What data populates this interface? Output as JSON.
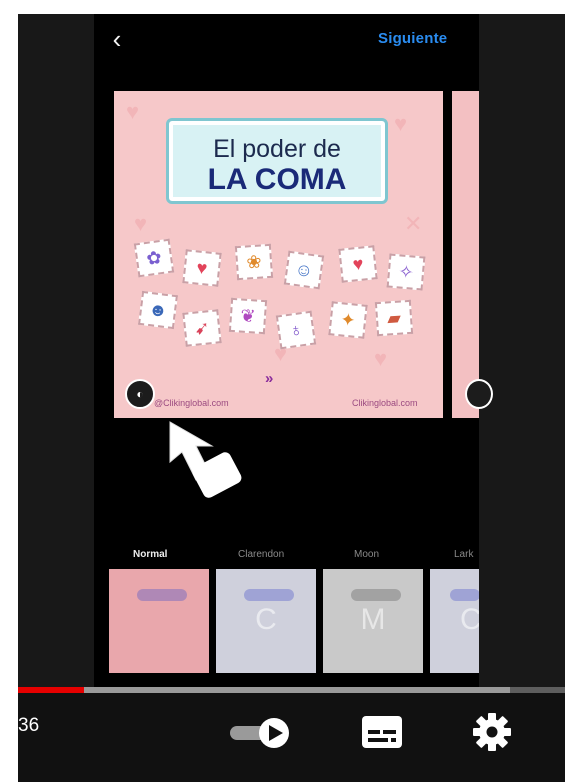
{
  "header": {
    "back_icon": "chevron-left-icon",
    "next_label": "Siguiente"
  },
  "post": {
    "title_line1": "El poder de",
    "title_line2": "LA COMA",
    "arrows": "»",
    "handle_left": "@Clikinglobal.com",
    "handle_right": "Clikinglobal.com"
  },
  "filters": {
    "items": [
      {
        "label": "Normal",
        "letter": "",
        "active": true
      },
      {
        "label": "Clarendon",
        "letter": "C",
        "active": false
      },
      {
        "label": "Moon",
        "letter": "M",
        "active": false
      },
      {
        "label": "Lark",
        "letter": "C",
        "active": false
      }
    ]
  },
  "player": {
    "time": "36",
    "progress_played": 0.12,
    "progress_buffered": 0.9,
    "autoplay_icon": "autoplay-toggle-icon",
    "captions_icon": "closed-captions-icon",
    "settings_icon": "gear-icon"
  },
  "colors": {
    "accent_blue": "#2a8cf0",
    "progress_red": "#e60000",
    "card_pink": "#f6c8c9"
  }
}
